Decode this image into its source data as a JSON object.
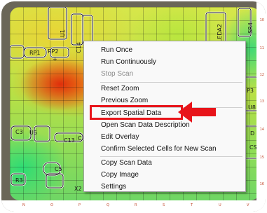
{
  "board_labels": {
    "u1": "U1",
    "c14": "C14",
    "leda2": "LEDA2",
    "sr4": "SR4",
    "rp1": "RP1",
    "rp2": "RP2",
    "plus": "+",
    "c3": "C3",
    "u5": "U5",
    "c13": "C13",
    "c13b": "C",
    "c5": "C5",
    "r3": "R3",
    "x2": "X2",
    "rp3": "P3",
    "u8": "U8",
    "d": "D",
    "cs": "CS"
  },
  "right_axis": [
    "10",
    "11",
    "12",
    "13",
    "14",
    "15",
    "16"
  ],
  "bottom_axis": [
    "N",
    "O",
    "P",
    "Q",
    "R",
    "S",
    "T",
    "U",
    "V"
  ],
  "context_menu": {
    "items": [
      {
        "label": "Run Once",
        "enabled": true
      },
      {
        "label": "Run Continuously",
        "enabled": true
      },
      {
        "label": "Stop Scan",
        "enabled": false
      },
      {
        "label": "Reset Zoom",
        "enabled": true
      },
      {
        "label": "Previous Zoom",
        "enabled": true
      },
      {
        "label": "Export Spatial Data",
        "enabled": true,
        "highlighted": true
      },
      {
        "label": "Open Scan Data Description",
        "enabled": true
      },
      {
        "label": "Edit Overlay",
        "enabled": true
      },
      {
        "label": "Confirm Selected Cells for New Scan",
        "enabled": true
      },
      {
        "label": "Copy Scan Data",
        "enabled": true
      },
      {
        "label": "Copy Image",
        "enabled": true
      },
      {
        "label": "Settings",
        "enabled": true
      }
    ]
  },
  "colors": {
    "highlight_box": "#e8141a",
    "arrow": "#e8141a",
    "frame": "#6a6658",
    "axis_text": "#c24a2f"
  }
}
